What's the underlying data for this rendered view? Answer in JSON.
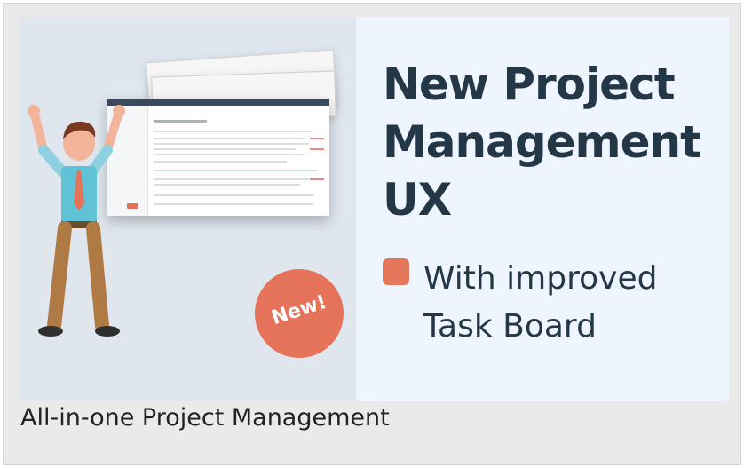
{
  "banner": {
    "headline": [
      "New Project",
      "Management",
      "UX"
    ],
    "subline": [
      "With improved",
      "Task Board"
    ],
    "badge": "New!",
    "colors": {
      "accent": "#e5735a",
      "heading": "#243746",
      "background": "#eef5fe"
    }
  },
  "caption": "All-in-one Project Management"
}
